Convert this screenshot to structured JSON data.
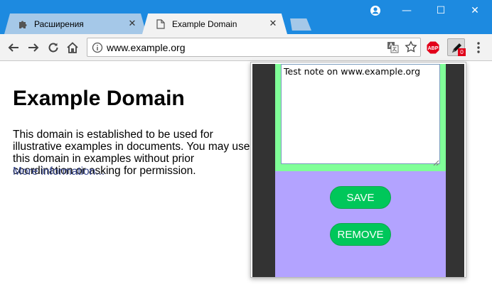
{
  "browser": {
    "tabs": [
      {
        "label": "Расширения",
        "icon": "puzzle-icon",
        "active": false
      },
      {
        "label": "Example Domain",
        "icon": "page-icon",
        "active": true
      }
    ],
    "close_glyph": "✕",
    "window_controls": {
      "minimize": "—",
      "maximize": "☐",
      "close": "✕"
    },
    "accent_color": "#1d8ae0"
  },
  "toolbar": {
    "url": "www.example.org",
    "extension_badge": "0",
    "abp_label": "ABP"
  },
  "page": {
    "title": "Example Domain",
    "body": "This domain is established to be used for illustrative examples in documents. You may use this domain in examples without prior coordination or asking for permission.",
    "link": "More information..."
  },
  "popup": {
    "note_text": "Test note on www.example.org",
    "save_label": "SAVE",
    "remove_label": "REMOVE",
    "colors": {
      "panel": "#80ff98",
      "actions": "#b3a3ff",
      "button": "#00c75a"
    }
  }
}
